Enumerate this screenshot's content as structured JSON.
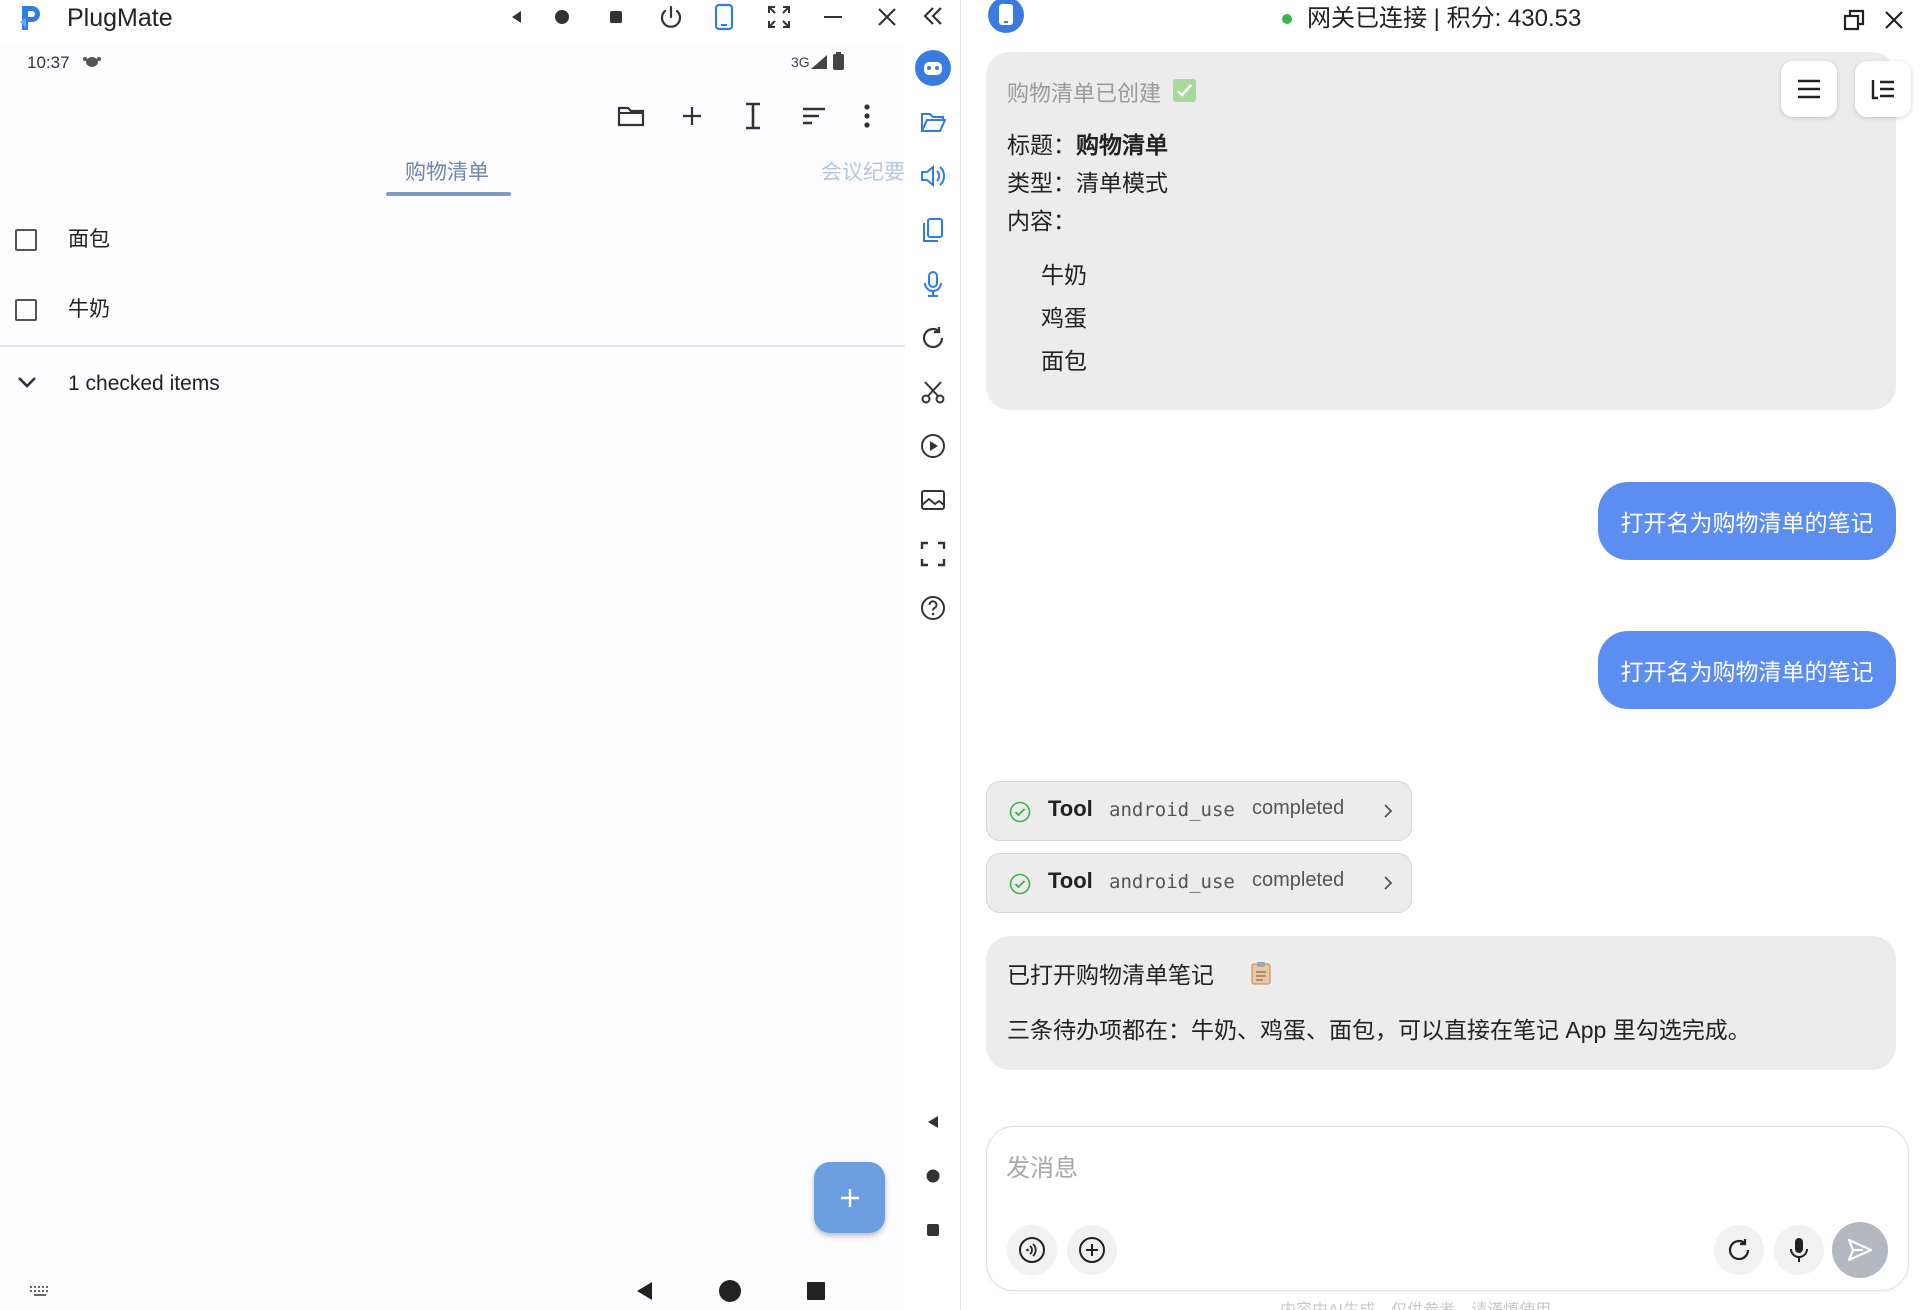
{
  "emulator": {
    "title": "PlugMate",
    "status_time": "10:37",
    "status_network": "3G",
    "tabs": [
      {
        "label": "购物清单",
        "active": true
      },
      {
        "label": "会议纪要",
        "active": false
      }
    ],
    "items": [
      {
        "label": "面包",
        "checked": false
      },
      {
        "label": "牛奶",
        "checked": false
      }
    ],
    "checked_summary": "1 checked items",
    "fab_icon": "plus-icon",
    "accent_color": "#6b9ee0"
  },
  "chat": {
    "status": {
      "connected_text": "网关已连接 | 积分: 430.53",
      "dot_color": "#39b54a"
    },
    "messages": {
      "assistant_created": {
        "header": "购物清单已创建",
        "title_label": "标题：",
        "title_value": "购物清单",
        "type_label": "类型：",
        "type_value": "清单模式",
        "content_label": "内容：",
        "content_items": [
          "牛奶",
          "鸡蛋",
          "面包"
        ]
      },
      "user_1": "打开名为购物清单的笔记",
      "user_2": "打开名为购物清单的笔记",
      "tool_calls": [
        {
          "label": "Tool",
          "name": "android_use",
          "status": "completed"
        },
        {
          "label": "Tool",
          "name": "android_use",
          "status": "completed"
        }
      ],
      "assistant_opened": {
        "title": "已打开购物清单笔记",
        "body": "三条待办项都在：牛奶、鸡蛋、面包，可以直接在笔记 App 里勾选完成。"
      }
    },
    "composer": {
      "placeholder": "发消息"
    },
    "disclaimer": "内容由AI生成，仅供参考，请谨慎使用",
    "user_bubble_color": "#5c8ef2"
  }
}
